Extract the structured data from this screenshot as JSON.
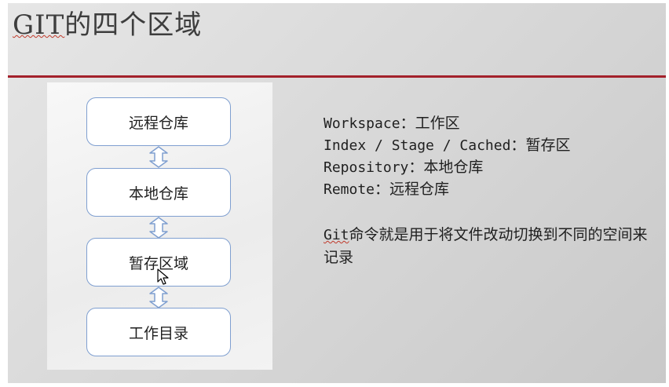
{
  "slide": {
    "title_git": "GIT",
    "title_rest": "的四个区域"
  },
  "diagram": {
    "nodes": [
      "远程仓库",
      "本地仓库",
      "暂存区域",
      "工作目录"
    ]
  },
  "definitions": [
    {
      "term": "Workspace",
      "sep": "：",
      "meaning": "工作区"
    },
    {
      "term": "Index / Stage / Cached",
      "sep": "：",
      "meaning": "暂存区"
    },
    {
      "term": "Repository",
      "sep": "：",
      "meaning": "本地仓库"
    },
    {
      "term": "Remote",
      "sep": "：",
      "meaning": "远程仓库"
    }
  ],
  "paragraph": {
    "git_word": "Git",
    "rest": "命令就是用于将文件改动切换到不同的空间来记录"
  },
  "colors": {
    "rule": "#a3212b",
    "node_border": "#7f9fd0",
    "connector": "#7f9fd0"
  },
  "icons": [
    "double-arrow-icon",
    "mouse-cursor-icon"
  ]
}
